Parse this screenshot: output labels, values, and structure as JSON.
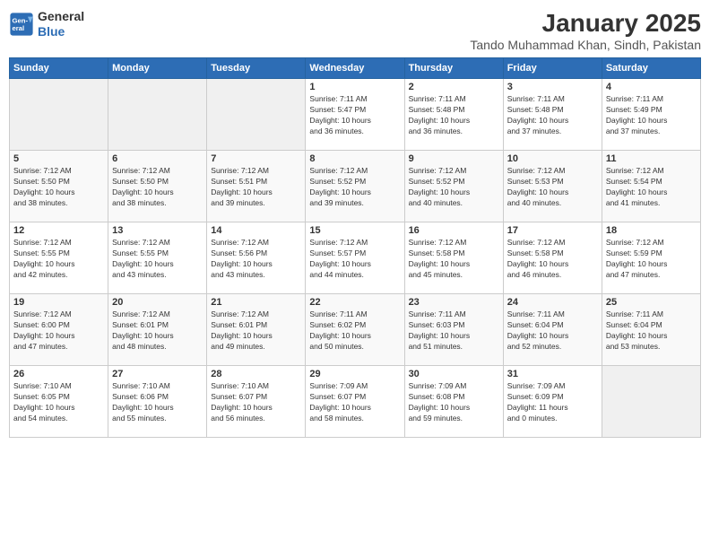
{
  "header": {
    "logo_line1": "General",
    "logo_line2": "Blue",
    "title": "January 2025",
    "subtitle": "Tando Muhammad Khan, Sindh, Pakistan"
  },
  "days_of_week": [
    "Sunday",
    "Monday",
    "Tuesday",
    "Wednesday",
    "Thursday",
    "Friday",
    "Saturday"
  ],
  "weeks": [
    [
      {
        "day": "",
        "info": ""
      },
      {
        "day": "",
        "info": ""
      },
      {
        "day": "",
        "info": ""
      },
      {
        "day": "1",
        "info": "Sunrise: 7:11 AM\nSunset: 5:47 PM\nDaylight: 10 hours\nand 36 minutes."
      },
      {
        "day": "2",
        "info": "Sunrise: 7:11 AM\nSunset: 5:48 PM\nDaylight: 10 hours\nand 36 minutes."
      },
      {
        "day": "3",
        "info": "Sunrise: 7:11 AM\nSunset: 5:48 PM\nDaylight: 10 hours\nand 37 minutes."
      },
      {
        "day": "4",
        "info": "Sunrise: 7:11 AM\nSunset: 5:49 PM\nDaylight: 10 hours\nand 37 minutes."
      }
    ],
    [
      {
        "day": "5",
        "info": "Sunrise: 7:12 AM\nSunset: 5:50 PM\nDaylight: 10 hours\nand 38 minutes."
      },
      {
        "day": "6",
        "info": "Sunrise: 7:12 AM\nSunset: 5:50 PM\nDaylight: 10 hours\nand 38 minutes."
      },
      {
        "day": "7",
        "info": "Sunrise: 7:12 AM\nSunset: 5:51 PM\nDaylight: 10 hours\nand 39 minutes."
      },
      {
        "day": "8",
        "info": "Sunrise: 7:12 AM\nSunset: 5:52 PM\nDaylight: 10 hours\nand 39 minutes."
      },
      {
        "day": "9",
        "info": "Sunrise: 7:12 AM\nSunset: 5:52 PM\nDaylight: 10 hours\nand 40 minutes."
      },
      {
        "day": "10",
        "info": "Sunrise: 7:12 AM\nSunset: 5:53 PM\nDaylight: 10 hours\nand 40 minutes."
      },
      {
        "day": "11",
        "info": "Sunrise: 7:12 AM\nSunset: 5:54 PM\nDaylight: 10 hours\nand 41 minutes."
      }
    ],
    [
      {
        "day": "12",
        "info": "Sunrise: 7:12 AM\nSunset: 5:55 PM\nDaylight: 10 hours\nand 42 minutes."
      },
      {
        "day": "13",
        "info": "Sunrise: 7:12 AM\nSunset: 5:55 PM\nDaylight: 10 hours\nand 43 minutes."
      },
      {
        "day": "14",
        "info": "Sunrise: 7:12 AM\nSunset: 5:56 PM\nDaylight: 10 hours\nand 43 minutes."
      },
      {
        "day": "15",
        "info": "Sunrise: 7:12 AM\nSunset: 5:57 PM\nDaylight: 10 hours\nand 44 minutes."
      },
      {
        "day": "16",
        "info": "Sunrise: 7:12 AM\nSunset: 5:58 PM\nDaylight: 10 hours\nand 45 minutes."
      },
      {
        "day": "17",
        "info": "Sunrise: 7:12 AM\nSunset: 5:58 PM\nDaylight: 10 hours\nand 46 minutes."
      },
      {
        "day": "18",
        "info": "Sunrise: 7:12 AM\nSunset: 5:59 PM\nDaylight: 10 hours\nand 47 minutes."
      }
    ],
    [
      {
        "day": "19",
        "info": "Sunrise: 7:12 AM\nSunset: 6:00 PM\nDaylight: 10 hours\nand 47 minutes."
      },
      {
        "day": "20",
        "info": "Sunrise: 7:12 AM\nSunset: 6:01 PM\nDaylight: 10 hours\nand 48 minutes."
      },
      {
        "day": "21",
        "info": "Sunrise: 7:12 AM\nSunset: 6:01 PM\nDaylight: 10 hours\nand 49 minutes."
      },
      {
        "day": "22",
        "info": "Sunrise: 7:11 AM\nSunset: 6:02 PM\nDaylight: 10 hours\nand 50 minutes."
      },
      {
        "day": "23",
        "info": "Sunrise: 7:11 AM\nSunset: 6:03 PM\nDaylight: 10 hours\nand 51 minutes."
      },
      {
        "day": "24",
        "info": "Sunrise: 7:11 AM\nSunset: 6:04 PM\nDaylight: 10 hours\nand 52 minutes."
      },
      {
        "day": "25",
        "info": "Sunrise: 7:11 AM\nSunset: 6:04 PM\nDaylight: 10 hours\nand 53 minutes."
      }
    ],
    [
      {
        "day": "26",
        "info": "Sunrise: 7:10 AM\nSunset: 6:05 PM\nDaylight: 10 hours\nand 54 minutes."
      },
      {
        "day": "27",
        "info": "Sunrise: 7:10 AM\nSunset: 6:06 PM\nDaylight: 10 hours\nand 55 minutes."
      },
      {
        "day": "28",
        "info": "Sunrise: 7:10 AM\nSunset: 6:07 PM\nDaylight: 10 hours\nand 56 minutes."
      },
      {
        "day": "29",
        "info": "Sunrise: 7:09 AM\nSunset: 6:07 PM\nDaylight: 10 hours\nand 58 minutes."
      },
      {
        "day": "30",
        "info": "Sunrise: 7:09 AM\nSunset: 6:08 PM\nDaylight: 10 hours\nand 59 minutes."
      },
      {
        "day": "31",
        "info": "Sunrise: 7:09 AM\nSunset: 6:09 PM\nDaylight: 11 hours\nand 0 minutes."
      },
      {
        "day": "",
        "info": ""
      }
    ]
  ]
}
